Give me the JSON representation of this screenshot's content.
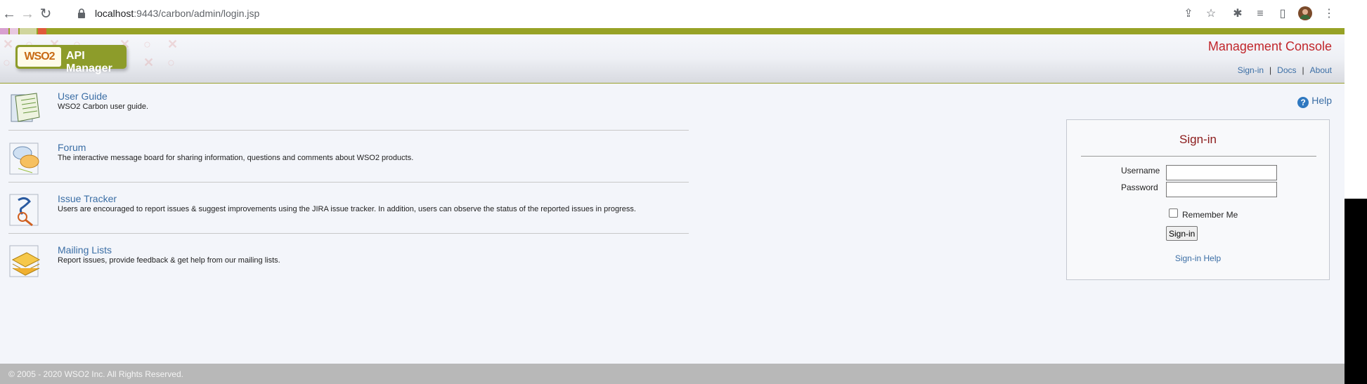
{
  "browser": {
    "url_host": "localhost",
    "url_path": ":9443/carbon/admin/login.jsp"
  },
  "header": {
    "logo_brand": "WSO2",
    "logo_product": "API Manager",
    "title": "Management Console",
    "links": [
      "Sign-in",
      "Docs",
      "About"
    ],
    "separator": "|"
  },
  "help": {
    "label": "Help",
    "icon": "question-icon"
  },
  "resources": [
    {
      "title": "User Guide",
      "desc": "WSO2 Carbon user guide.",
      "icon": "user-guide-book-icon"
    },
    {
      "title": "Forum",
      "desc": "The interactive message board for sharing information, questions and comments about WSO2 products.",
      "icon": "forum-speech-bubble-icon"
    },
    {
      "title": "Issue Tracker",
      "desc": "Users are encouraged to report issues & suggest improvements using the JIRA issue tracker. In addition, users can observe the status of the reported issues in progress.",
      "icon": "issue-tracker-magnifier-icon"
    },
    {
      "title": "Mailing Lists",
      "desc": "Report issues, provide feedback & get help from our mailing lists.",
      "icon": "mailing-list-envelopes-icon"
    }
  ],
  "signin": {
    "title": "Sign-in",
    "username_label": "Username",
    "password_label": "Password",
    "username_value": "",
    "password_value": "",
    "remember_label": "Remember Me",
    "remember_checked": false,
    "button_label": "Sign-in",
    "help_link": "Sign-in Help"
  },
  "footer": {
    "text": "© 2005 - 2020 WSO2 Inc. All Rights Reserved."
  },
  "colors": {
    "accent_green": "#97a226",
    "title_red": "#c1262b",
    "link_blue": "#3b6ea5",
    "signin_title": "#8b1a1a"
  }
}
